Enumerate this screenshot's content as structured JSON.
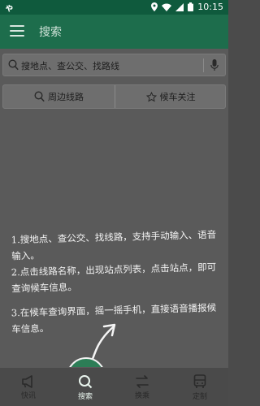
{
  "status_bar": {
    "left_glyph": "ゃ",
    "time": "10:15"
  },
  "app_bar": {
    "title": "搜索"
  },
  "search": {
    "placeholder": "搜地点、查公交、找路线"
  },
  "quick_actions": {
    "nearby_label": "周边线路",
    "favorites_label": "候车关注"
  },
  "hints": [
    "1.搜地点、查公交、找线路，支持手动输入、语音输入。",
    "2.点击线路名称，出现站点列表，点击站点，即可查询候车信息。",
    "3.在候车查询界面，摇一摇手机，直接语音播报候车信息。"
  ],
  "bottom_nav": [
    {
      "label": "快讯",
      "icon": "megaphone-icon"
    },
    {
      "label": "搜索",
      "icon": "search-icon",
      "active": true
    },
    {
      "label": "换乘",
      "icon": "transfer-icon"
    },
    {
      "label": "定制",
      "icon": "bus-icon"
    }
  ],
  "colors": {
    "app_bar": "#1d6d4c",
    "status_bar": "#0f5a3d",
    "active_tab": "#2c7d56"
  }
}
